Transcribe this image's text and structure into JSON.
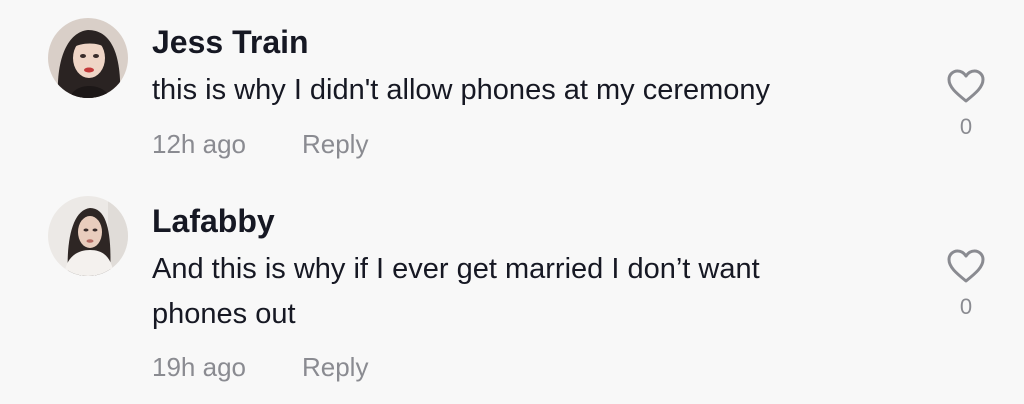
{
  "comments": [
    {
      "username": "Jess Train",
      "text": "this is why I didn't allow phones at my ceremony",
      "time": "12h ago",
      "reply_label": "Reply",
      "likes": "0"
    },
    {
      "username": "Lafabby",
      "text": "And this is why if I ever get married I don’t want phones out",
      "time": "19h ago",
      "reply_label": "Reply",
      "likes": "0"
    }
  ],
  "colors": {
    "background": "#f8f8f8",
    "text_primary": "#161823",
    "text_secondary": "#8a8b91"
  }
}
